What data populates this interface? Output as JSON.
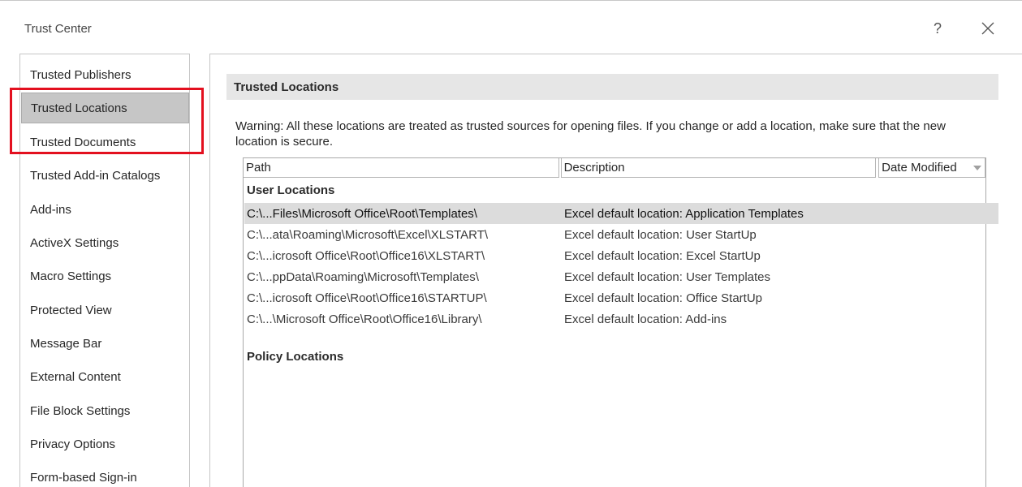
{
  "window": {
    "title": "Trust Center",
    "help_label": "?"
  },
  "sidebar": {
    "items": [
      {
        "label": "Trusted Publishers"
      },
      {
        "label": "Trusted Locations"
      },
      {
        "label": "Trusted Documents"
      },
      {
        "label": "Trusted Add-in Catalogs"
      },
      {
        "label": "Add-ins"
      },
      {
        "label": "ActiveX Settings"
      },
      {
        "label": "Macro Settings"
      },
      {
        "label": "Protected View"
      },
      {
        "label": "Message Bar"
      },
      {
        "label": "External Content"
      },
      {
        "label": "File Block Settings"
      },
      {
        "label": "Privacy Options"
      },
      {
        "label": "Form-based Sign-in"
      }
    ],
    "selected_item": "Trusted Locations"
  },
  "main": {
    "section_title": "Trusted Locations",
    "warning": "Warning: All these locations are treated as trusted sources for opening files.  If you change or add a location, make sure that the new location is secure.",
    "table": {
      "columns": [
        {
          "label": "Path"
        },
        {
          "label": "Description"
        },
        {
          "label": "Date Modified"
        }
      ],
      "groups": [
        {
          "label": "User Locations",
          "rows": [
            {
              "path": "C:\\...Files\\Microsoft Office\\Root\\Templates\\",
              "description": "Excel default location: Application Templates"
            },
            {
              "path": "C:\\...ata\\Roaming\\Microsoft\\Excel\\XLSTART\\",
              "description": "Excel default location: User StartUp"
            },
            {
              "path": "C:\\...icrosoft Office\\Root\\Office16\\XLSTART\\",
              "description": "Excel default location: Excel StartUp"
            },
            {
              "path": "C:\\...ppData\\Roaming\\Microsoft\\Templates\\",
              "description": "Excel default location: User Templates"
            },
            {
              "path": "C:\\...icrosoft Office\\Root\\Office16\\STARTUP\\",
              "description": "Excel default location: Office StartUp"
            },
            {
              "path": "C:\\...\\Microsoft Office\\Root\\Office16\\Library\\",
              "description": "Excel default location: Add-ins"
            }
          ]
        },
        {
          "label": "Policy Locations",
          "rows": []
        }
      ],
      "selected_row": 0
    }
  },
  "colors": {
    "highlight_annotation": "#e3101f",
    "selected_nav_bg": "#c6c6c6",
    "section_header_bg": "#e6e6e6",
    "selected_row_bg": "#dcdcdc"
  }
}
